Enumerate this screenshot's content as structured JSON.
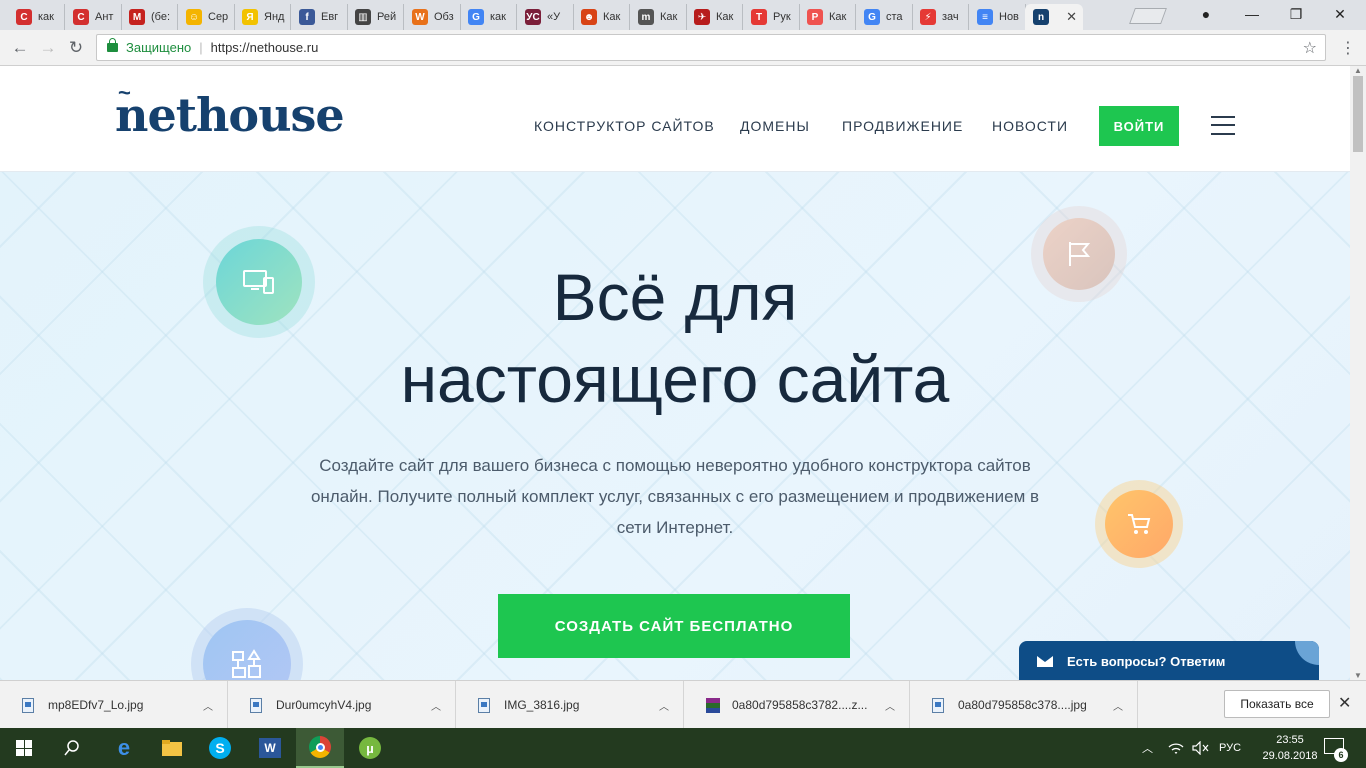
{
  "browser": {
    "tabs": [
      {
        "label": "как",
        "favicon": "C",
        "color": "#d32f2f"
      },
      {
        "label": "Ант",
        "favicon": "C",
        "color": "#d32f2f"
      },
      {
        "label": "(бе:",
        "favicon": "M",
        "color": "#c5221f"
      },
      {
        "label": "Сер",
        "favicon": "☺",
        "color": "#f4b400"
      },
      {
        "label": "Янд",
        "favicon": "Я",
        "color": "#f2c200"
      },
      {
        "label": "Евг",
        "favicon": "f",
        "color": "#3b5998"
      },
      {
        "label": "Рей",
        "favicon": "▥",
        "color": "#444444"
      },
      {
        "label": "Обз",
        "favicon": "W",
        "color": "#e8711a"
      },
      {
        "label": "как",
        "favicon": "G",
        "color": "#4285f4"
      },
      {
        "label": "«У",
        "favicon": "УС",
        "color": "#7b1f3a"
      },
      {
        "label": "Как",
        "favicon": "☻",
        "color": "#d84315"
      },
      {
        "label": "Как",
        "favicon": "m",
        "color": "#555555"
      },
      {
        "label": "Как",
        "favicon": "✈",
        "color": "#b71c1c"
      },
      {
        "label": "Рук",
        "favicon": "T",
        "color": "#e53935"
      },
      {
        "label": "Как",
        "favicon": "P",
        "color": "#ef5350"
      },
      {
        "label": "ста",
        "favicon": "G",
        "color": "#4285f4"
      },
      {
        "label": "зач",
        "favicon": "⚡",
        "color": "#e53935"
      },
      {
        "label": "Нов",
        "favicon": "≡",
        "color": "#4285f4"
      },
      {
        "label": "",
        "favicon": "n",
        "color": "#16416e",
        "active": true
      }
    ],
    "secure_label": "Защищено",
    "url": "https://nethouse.ru"
  },
  "site": {
    "logo": "nethouse",
    "nav": [
      "КОНСТРУКТОР САЙТОВ",
      "ДОМЕНЫ",
      "ПРОДВИЖЕНИЕ",
      "НОВОСТИ"
    ],
    "login_label": "ВОЙТИ",
    "hero": {
      "title_line1": "Всё для",
      "title_line2": "настоящего сайта",
      "text": "Создайте сайт для вашего бизнеса с помощью невероятно удобного конструктора сайтов онлайн. Получите полный комплект услуг, связанных с его размещением и продвижением в сети Интернет.",
      "cta_label": "СОЗДАТЬ САЙТ БЕСПЛАТНО"
    },
    "chat_label": "Есть вопросы? Ответим"
  },
  "downloads": {
    "items": [
      "mp8EDfv7_Lo.jpg",
      "Dur0umcyhV4.jpg",
      "IMG_3816.jpg",
      "0a80d795858c3782....z...",
      "0a80d795858c378....jpg"
    ],
    "show_all": "Показать все"
  },
  "taskbar": {
    "lang": "РУС",
    "time": "23:55",
    "date": "29.08.2018",
    "notifications": "6"
  },
  "colors": {
    "brand": "#16416e",
    "accent_green": "#1ec650",
    "chat_blue": "#0e4d87"
  }
}
